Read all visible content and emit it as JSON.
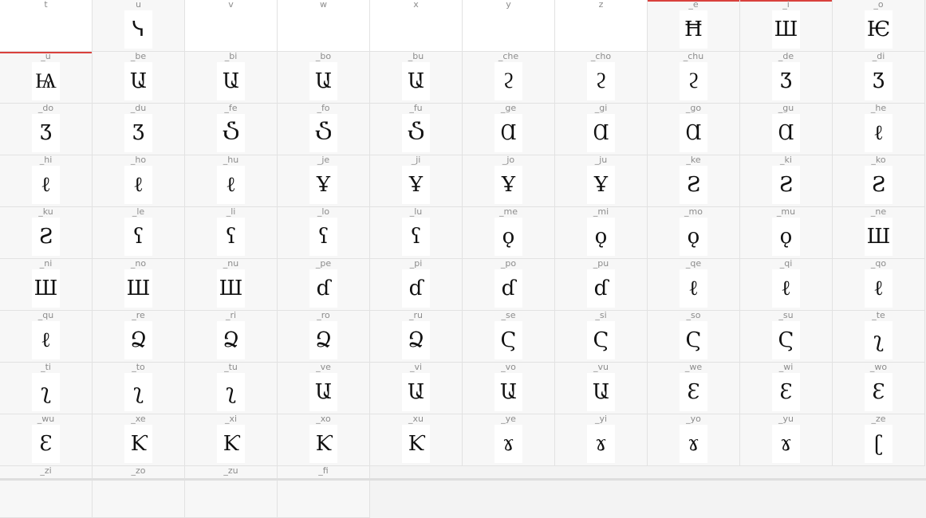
{
  "glyph_grid": {
    "rows": [
      [
        {
          "name": "t",
          "glyph": "",
          "empty": true
        },
        {
          "name": "u",
          "glyph": "ᓭ"
        },
        {
          "name": "v",
          "glyph": "",
          "empty": true
        },
        {
          "name": "w",
          "glyph": "",
          "empty": true
        },
        {
          "name": "x",
          "glyph": "",
          "empty": true
        },
        {
          "name": "y",
          "glyph": "",
          "empty": true
        },
        {
          "name": "z",
          "glyph": "",
          "empty": true
        },
        {
          "name": "_e",
          "glyph": "Ħ",
          "marked": true
        },
        {
          "name": "_i",
          "glyph": "Ш",
          "marked": true
        },
        {
          "name": "_o",
          "glyph": "Ѥ"
        }
      ],
      [
        {
          "name": "_u",
          "glyph": "Ѩ",
          "marked": true
        },
        {
          "name": "_be",
          "glyph": "Ա"
        },
        {
          "name": "_bi",
          "glyph": "Ա"
        },
        {
          "name": "_bo",
          "glyph": "Ա"
        },
        {
          "name": "_bu",
          "glyph": "Ա"
        },
        {
          "name": "_che",
          "glyph": "ϩ"
        },
        {
          "name": "_cho",
          "glyph": "ϩ"
        },
        {
          "name": "_chu",
          "glyph": "ϩ"
        },
        {
          "name": "_de",
          "glyph": "Ʒ"
        },
        {
          "name": "_di",
          "glyph": "Ʒ"
        }
      ],
      [
        {
          "name": "_do",
          "glyph": "Ʒ"
        },
        {
          "name": "_du",
          "glyph": "Ʒ"
        },
        {
          "name": "_fe",
          "glyph": "Ⴢ"
        },
        {
          "name": "_fo",
          "glyph": "Ⴢ"
        },
        {
          "name": "_fu",
          "glyph": "Ⴢ"
        },
        {
          "name": "_ge",
          "glyph": "Ɑ"
        },
        {
          "name": "_gi",
          "glyph": "Ɑ"
        },
        {
          "name": "_go",
          "glyph": "Ɑ"
        },
        {
          "name": "_gu",
          "glyph": "Ɑ"
        },
        {
          "name": "_he",
          "glyph": "ℓ"
        }
      ],
      [
        {
          "name": "_hi",
          "glyph": "ℓ"
        },
        {
          "name": "_ho",
          "glyph": "ℓ"
        },
        {
          "name": "_hu",
          "glyph": "ℓ"
        },
        {
          "name": "_je",
          "glyph": "Ұ"
        },
        {
          "name": "_ji",
          "glyph": "Ұ"
        },
        {
          "name": "_jo",
          "glyph": "Ұ"
        },
        {
          "name": "_ju",
          "glyph": "Ұ"
        },
        {
          "name": "_ke",
          "glyph": "Ƨ"
        },
        {
          "name": "_ki",
          "glyph": "Ƨ"
        },
        {
          "name": "_ko",
          "glyph": "Ƨ"
        }
      ],
      [
        {
          "name": "_ku",
          "glyph": "Ƨ"
        },
        {
          "name": "_le",
          "glyph": "ʕ"
        },
        {
          "name": "_li",
          "glyph": "ʕ"
        },
        {
          "name": "_lo",
          "glyph": "ʕ"
        },
        {
          "name": "_lu",
          "glyph": "ʕ"
        },
        {
          "name": "_me",
          "glyph": "ǫ"
        },
        {
          "name": "_mi",
          "glyph": "ǫ"
        },
        {
          "name": "_mo",
          "glyph": "ǫ"
        },
        {
          "name": "_mu",
          "glyph": "ǫ"
        },
        {
          "name": "_ne",
          "glyph": "Ш"
        }
      ],
      [
        {
          "name": "_ni",
          "glyph": "Ш"
        },
        {
          "name": "_no",
          "glyph": "Ш"
        },
        {
          "name": "_nu",
          "glyph": "Ш"
        },
        {
          "name": "_pe",
          "glyph": "ɗ"
        },
        {
          "name": "_pi",
          "glyph": "ɗ"
        },
        {
          "name": "_po",
          "glyph": "ɗ"
        },
        {
          "name": "_pu",
          "glyph": "ɗ"
        },
        {
          "name": "_qe",
          "glyph": "ℓ"
        },
        {
          "name": "_qi",
          "glyph": "ℓ"
        },
        {
          "name": "_qo",
          "glyph": "ℓ"
        }
      ],
      [
        {
          "name": "_qu",
          "glyph": "ℓ"
        },
        {
          "name": "_re",
          "glyph": "Ձ"
        },
        {
          "name": "_ri",
          "glyph": "Ձ"
        },
        {
          "name": "_ro",
          "glyph": "Ձ"
        },
        {
          "name": "_ru",
          "glyph": "Ձ"
        },
        {
          "name": "_se",
          "glyph": "Ϛ"
        },
        {
          "name": "_si",
          "glyph": "Ϛ"
        },
        {
          "name": "_so",
          "glyph": "Ϛ"
        },
        {
          "name": "_su",
          "glyph": "Ϛ"
        },
        {
          "name": "_te",
          "glyph": "ʅ"
        }
      ],
      [
        {
          "name": "_ti",
          "glyph": "ʅ"
        },
        {
          "name": "_to",
          "glyph": "ʅ"
        },
        {
          "name": "_tu",
          "glyph": "ʅ"
        },
        {
          "name": "_ve",
          "glyph": "Ա"
        },
        {
          "name": "_vi",
          "glyph": "Ա"
        },
        {
          "name": "_vo",
          "glyph": "Ա"
        },
        {
          "name": "_vu",
          "glyph": "Ա"
        },
        {
          "name": "_we",
          "glyph": "Ɛ"
        },
        {
          "name": "_wi",
          "glyph": "Ɛ"
        },
        {
          "name": "_wo",
          "glyph": "Ɛ"
        }
      ],
      [
        {
          "name": "_wu",
          "glyph": "Ɛ"
        },
        {
          "name": "_xe",
          "glyph": "Ƙ"
        },
        {
          "name": "_xi",
          "glyph": "Ƙ"
        },
        {
          "name": "_xo",
          "glyph": "Ƙ"
        },
        {
          "name": "_xu",
          "glyph": "Ƙ"
        },
        {
          "name": "_ye",
          "glyph": "ɤ"
        },
        {
          "name": "_yi",
          "glyph": "ɤ"
        },
        {
          "name": "_yo",
          "glyph": "ɤ"
        },
        {
          "name": "_yu",
          "glyph": "ɤ"
        },
        {
          "name": "_ze",
          "glyph": "ʗ"
        }
      ],
      [
        {
          "name": "_zi",
          "glyph": ""
        },
        {
          "name": "_zo",
          "glyph": ""
        },
        {
          "name": "_zu",
          "glyph": ""
        },
        {
          "name": "_fi",
          "glyph": ""
        }
      ]
    ]
  },
  "colors": {
    "marker": "#d9413d",
    "cell_background": "#f7f7f7",
    "empty_cell_background": "#ffffff"
  }
}
